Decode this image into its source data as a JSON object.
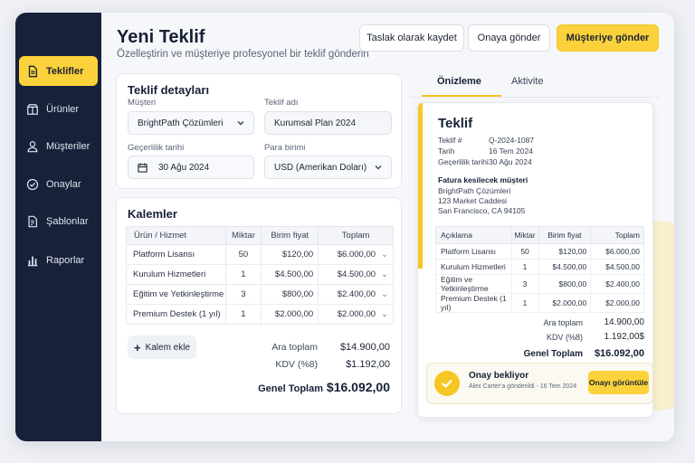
{
  "sidebar": {
    "items": [
      {
        "label": "Teklifler",
        "icon": "document-icon",
        "active": true
      },
      {
        "label": "Ürünler",
        "icon": "box-icon"
      },
      {
        "label": "Müşteriler",
        "icon": "user-icon"
      },
      {
        "label": "Onaylar",
        "icon": "check-circle-icon"
      },
      {
        "label": "Şablonlar",
        "icon": "template-icon"
      },
      {
        "label": "Raporlar",
        "icon": "bar-chart-icon"
      }
    ]
  },
  "header": {
    "title": "Yeni Teklif",
    "subtitle": "Özelleştirin ve müşteriye profesyonel bir teklif gönderin",
    "buttons": {
      "draft": "Taslak olarak kaydet",
      "approval": "Onaya gönder",
      "send": "Müşteriye gönder"
    }
  },
  "details": {
    "title": "Teklif detayları",
    "customer_label": "Müşteri",
    "customer_value": "BrightPath Çözümleri",
    "offer_name_label": "Teklif adı",
    "offer_name_value": "Kurumsal Plan 2024",
    "validity_label": "Geçerlilik tarihi",
    "validity_value": "30 Ağu 2024",
    "currency_label": "Para birimi",
    "currency_value": "USD (Amerikan Doları)"
  },
  "items": {
    "title": "Kalemler",
    "headers": [
      "Ürün / Hizmet",
      "Miktar",
      "Birim fiyat",
      "Toplam"
    ],
    "rows": [
      {
        "name": "Platform Lisansı",
        "qty": "50",
        "price": "$120,00",
        "total": "$6.000,00"
      },
      {
        "name": "Kurulum Hizmetleri",
        "qty": "1",
        "price": "$4.500,00",
        "total": "$4.500,00"
      },
      {
        "name": "Eğitim ve Yetkinleştirme",
        "qty": "3",
        "price": "$800,00",
        "total": "$2.400,00"
      },
      {
        "name": "Premium Destek (1 yıl)",
        "qty": "1",
        "price": "$2.000,00",
        "total": "$2.000,00"
      }
    ],
    "add_label": "Kalem ekle",
    "subtotal_label": "Ara toplam",
    "subtotal_value": "$14.900,00",
    "tax_label": "KDV (%8)",
    "tax_value": "$1.192,00",
    "grand_label": "Genel Toplam",
    "grand_value": "$16.092,00"
  },
  "preview_tabs": {
    "preview": "Önizleme",
    "activity": "Aktivite"
  },
  "preview": {
    "heading": "Teklif",
    "meta": [
      {
        "k": "Teklif #",
        "v": "Q-2024-1087"
      },
      {
        "k": "Tarih",
        "v": "16 Tem 2024"
      },
      {
        "k": "Geçerlilik tarihi",
        "v": "30 Ağu 2024"
      }
    ],
    "bill_title": "Fatura kesilecek müşteri",
    "bill_lines": [
      "BrightPath Çözümleri",
      "123 Market Caddesi",
      "San Francisco, CA 94105"
    ],
    "headers": [
      "Açıklama",
      "Miktar",
      "Birim fiyat",
      "Toplam"
    ],
    "rows": [
      {
        "name": "Platform Lisansı",
        "qty": "50",
        "price": "$120,00",
        "total": "$6.000,00"
      },
      {
        "name": "Kurulum Hizmetleri",
        "qty": "1",
        "price": "$4.500,00",
        "total": "$4.500,00"
      },
      {
        "name": "Eğitim ve Yetkinleştirme",
        "qty": "3",
        "price": "$800,00",
        "total": "$2.400,00"
      },
      {
        "name": "Premium Destek (1 yıl)",
        "qty": "1",
        "price": "$2.000,00",
        "total": "$2.000,00"
      }
    ],
    "subtotal_label": "Ara toplam",
    "subtotal_value": "14.900,00",
    "tax_label": "KDV (%8)",
    "tax_value": "1.192,00$",
    "grand_label": "Genel Toplam",
    "grand_value": "$16.092,00"
  },
  "approval": {
    "title": "Onay bekliyor",
    "sub": "Alex Carter'a gönderildi - 16 Tem 2024",
    "button": "Onayı görüntüle"
  },
  "colors": {
    "accent": "#fbd23b",
    "sidebar": "#17213a",
    "success": "#f6c623"
  }
}
